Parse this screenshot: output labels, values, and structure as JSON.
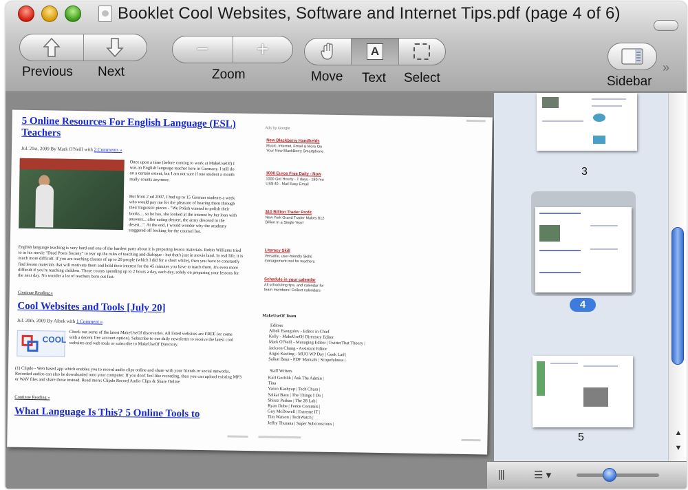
{
  "window": {
    "title": "Booklet Cool Websites, Software and Internet Tips.pdf (page 4 of 6)"
  },
  "toolbar": {
    "previous_label": "Previous",
    "next_label": "Next",
    "zoom_label": "Zoom",
    "zoom_out_symbol": "−",
    "zoom_in_symbol": "+",
    "move_label": "Move",
    "text_label": "Text",
    "select_label": "Select",
    "sidebar_label": "Sidebar",
    "overflow_symbol": "»",
    "text_tool_glyph": "A",
    "active_tool": "Text"
  },
  "document": {
    "article1": {
      "title": "5 Online Resources For English Language (ESL) Teachers",
      "meta": "Jul. 21st, 2009 By Mark O'Neill with",
      "meta_link": "2 Comments »",
      "para1": "Once upon a time (before coming to work at MakeUseOf) I was an English language teacher here in Germany. I still do on a certain extent, but I am not sure if one student a month really counts anymore.",
      "para2": "But from 2 nd 2007, I had up to 15 German students a week who would pay me for the pleasure of hearing them through their linguistic pieces - \"We Polish wanted to polish their books.... so he has, she looked at the interest by her loan with answers... after eating dessert, the army descend to the desert...\". At the end, I would wonder why the academy staggered off looking for the counsel bar.",
      "para3": "English language teaching is very hard and one of the hardest parts about it is preparing lesson materials. Robin Williams tried to in his movie \"Dead Poets Society\" to tear up the rules of teaching and dialogue - but that's just in movie land. In real life, it is much more difficult. If you are teaching classes of up to 20 people (which I did for a short while), then you have to constantly find lesson materials that will motivate them and hold their interest for the 45 minutes you have to teach them. It's even more difficult if you're teaching children. Those counts spending up to 2 hours a day, each day, solely on preparing your lessons for the next day. No wonder a lot of teachers burn out fast.",
      "more": "Continue Reading »"
    },
    "article2": {
      "title": "Cool Websites and Tools [July 20]",
      "meta": "Jul. 20th, 2009 By Aibek with",
      "meta_link": "1 Comment »",
      "logo_text": "COOL",
      "para1": "Check out some of the latest MakeUseOf discoveries. All listed websites are FREE (or come with a decent free account option). Subscribe to our daily newsletter to receive the latest cool websites and web tools or subscribe to MakeUseOf Directory.",
      "para2": "(1) Clipdo - Web based app which enables you to record audio clips online and share with your friends or social networks. Recorded audios can also be downloaded onto your computer. If you don't feel like recording, then you can upload existing MP3 or WAV files and share those instead. Read more: Clipdo Record Audio Clips & Share Online",
      "more": "Continue Reading »"
    },
    "article3": {
      "title": "What Language Is This? 5 Online Tools to"
    },
    "sidebar_col": {
      "ads_header": "Ads by Google",
      "ads": [
        {
          "title": "New Blackberry Handhelds",
          "text": "Music, Internet, Email & More On Your New BlackBerry Smartphone"
        },
        {
          "title": "1000 Euros Free Daily - Now",
          "text": "1000 Get Hourly - 1 days - 180 mo US$ 40 - Mail Easy Email"
        },
        {
          "title": "$10 Billion Trader Profit",
          "text": "New York Grand Trader Makes $12 Billion In a Single Year!"
        },
        {
          "title": "Literacy Skill",
          "text": "Versatile, user-friendly Skills management tool for teachers"
        },
        {
          "title": "Schedule in your calendar",
          "text": "All scheduling tips, and calendar for team members! Collect calendars"
        }
      ],
      "team_header": "MakeUseOf Team",
      "editors_header": "Editors",
      "editors": [
        "Aibek Esengulov - Editor in Chief",
        "Kelly - MakeUseOf Directory Editor",
        "Mark O'Neill - Managing Editor | TwitterThat Theory |",
        "Jackson Chung - Assistant Editor",
        "Angie Keeling - MUO WP Day | Geek Lad |",
        "Saikat Basu - PDF Manuals | Scopefulness |"
      ],
      "staff_header": "Staff Writers",
      "staff": [
        "Karl Gechlik | Ask The Admin |",
        "Tina",
        "Varun Kashyap | Tech Chara |",
        "Saikat Basu | The Things I Do |",
        "Shiraz Pathan | The 28 Lab |",
        "Ryan Dube | Fence Commits |",
        "Guy McDowell | Extreme IT |",
        "Tim Watson | TechWatch |",
        "Jeffry Thurana | Super Subconscious |"
      ]
    }
  },
  "sidebar": {
    "page_numbers": [
      "3",
      "4",
      "5"
    ],
    "selected_page": "4"
  },
  "bottombar": {
    "resize_glyph": "|||",
    "view_options_glyph": "☰ ▾"
  },
  "colors": {
    "link_blue": "#1a2bcc",
    "selection_blue": "#3d7bdc",
    "sidebar_bg": "#dfe6ef"
  }
}
